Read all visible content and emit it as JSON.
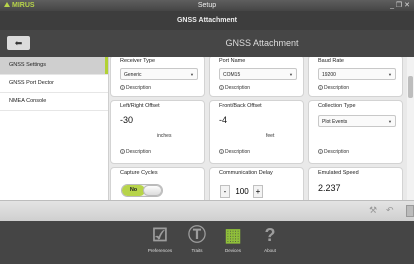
{
  "window": {
    "logo": "MIRUS",
    "title": "Setup",
    "controls": "_ ❐ ✕"
  },
  "page": {
    "subtitle": "GNSS Attachment",
    "nav_title": "GNSS Attachment",
    "back_icon": "back-arrow-icon"
  },
  "sidebar": {
    "items": [
      {
        "label": "GNSS Settings",
        "active": true
      },
      {
        "label": "GNSS Port Dector",
        "active": false
      },
      {
        "label": "NMEA Console",
        "active": false
      }
    ]
  },
  "cards": {
    "receiver_type": {
      "label": "Receiver Type",
      "value": "Generic",
      "desc": "Description"
    },
    "port_name": {
      "label": "Port Name",
      "value": "COM15",
      "desc": "Description"
    },
    "baud_rate": {
      "label": "Baud Rate",
      "value": "19200",
      "desc": "Description"
    },
    "lr_offset": {
      "label": "Left/Right Offset",
      "value": "-30",
      "unit": "inches",
      "desc": "Description"
    },
    "fb_offset": {
      "label": "Front/Back Offset",
      "value": "-4",
      "unit": "feet",
      "desc": "Description"
    },
    "collection_type": {
      "label": "Collection Type",
      "value": "Plot Events",
      "desc": "Description"
    },
    "capture_cycles": {
      "label": "Capture Cycles",
      "toggle_label": "No"
    },
    "comm_delay": {
      "label": "Communication Delay",
      "value": "100",
      "minus": "-",
      "plus": "+"
    },
    "emulated_speed": {
      "label": "Emulated Speed",
      "value": "2.237"
    }
  },
  "bottom_tabs": [
    {
      "label": "Preferences",
      "icon": "checkbox-icon"
    },
    {
      "label": "Traits",
      "icon": "traits-icon"
    },
    {
      "label": "Devices",
      "icon": "device-icon"
    },
    {
      "label": "About",
      "icon": "question-icon"
    }
  ],
  "colors": {
    "accent": "#b7d44a",
    "dark": "#454545"
  }
}
